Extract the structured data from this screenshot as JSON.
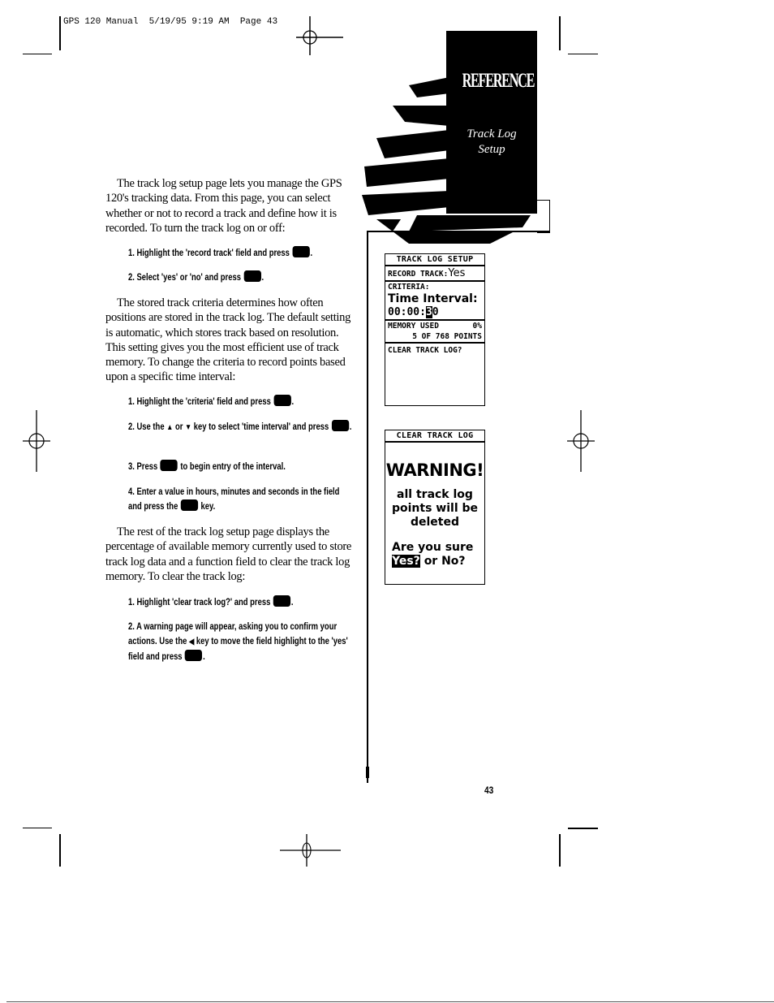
{
  "header": {
    "slug": "GPS 120 Manual  5/19/95 9:19 AM  Page 43"
  },
  "tab": {
    "section": "REFERENCE",
    "subtitle_line1": "Track Log",
    "subtitle_line2": "Setup"
  },
  "content": {
    "intro": "The track log setup page lets you manage the GPS 120's tracking data. From this page, you can select whether or not to record a track and define how it is recorded. To turn the track log on or off:",
    "steps_record": [
      {
        "num": "1.",
        "text_before": "Highlight the 'record track' field and press",
        "text_after": "."
      },
      {
        "num": "2.",
        "text_before": "Select 'yes' or 'no' and press",
        "text_after": "."
      }
    ],
    "criteria_para": "The stored track criteria determines how often positions are stored in the track log. The default setting is automatic, which stores track based on resolution. This setting gives you the most efficient use of track memory. To change the criteria to record points based upon a specific time interval:",
    "steps_criteria": [
      {
        "num": "1.",
        "text_before": "Highlight the 'criteria' field and press",
        "text_after": "."
      },
      {
        "num": "2.",
        "text_before": "Use the",
        "up": "▲",
        "or": "or",
        "down": "▼",
        "text_mid": "key to select 'time interval' and press",
        "text_after": "."
      },
      {
        "num": "3.",
        "text_before": "Press",
        "text_after": "to begin entry of the interval."
      },
      {
        "num": "4.",
        "text_before": "Enter a value in hours, minutes and seconds in the field and press the",
        "text_after": "key."
      }
    ],
    "rest_para": "The rest of the track log setup page displays the percentage of available memory currently used to store track log data and a function field to clear the track log memory. To clear the track log:",
    "steps_clear": [
      {
        "num": "1.",
        "text_before": "Highlight 'clear track log?' and press",
        "text_after": "."
      },
      {
        "num": "2.",
        "text_before": "A warning page will appear, asking you to confirm your actions. Use the",
        "left": "◀",
        "text_mid": "key to move the field highlight to the 'yes' field and press",
        "text_after": "."
      }
    ]
  },
  "screen_setup": {
    "title": "TRACK LOG SETUP",
    "record_label": "RECORD TRACK:",
    "record_value": "Yes",
    "criteria_label": "CRITERIA:",
    "criteria_value": "Time Interval:",
    "interval_prefix": "00:00:",
    "interval_cursor": "3",
    "interval_suffix": "0",
    "memory_label": "MEMORY USED",
    "memory_value": "0%",
    "points": "5 OF 768 POINTS",
    "clear_label": "CLEAR TRACK LOG?"
  },
  "screen_warning": {
    "title": "CLEAR TRACK LOG",
    "warning": "WARNING!",
    "msg1": "all track log",
    "msg2": "points will be",
    "msg3": "deleted",
    "question": "Are you sure",
    "yes": "Yes?",
    "or_no": "or No?"
  },
  "footer": {
    "page_number": "43"
  }
}
